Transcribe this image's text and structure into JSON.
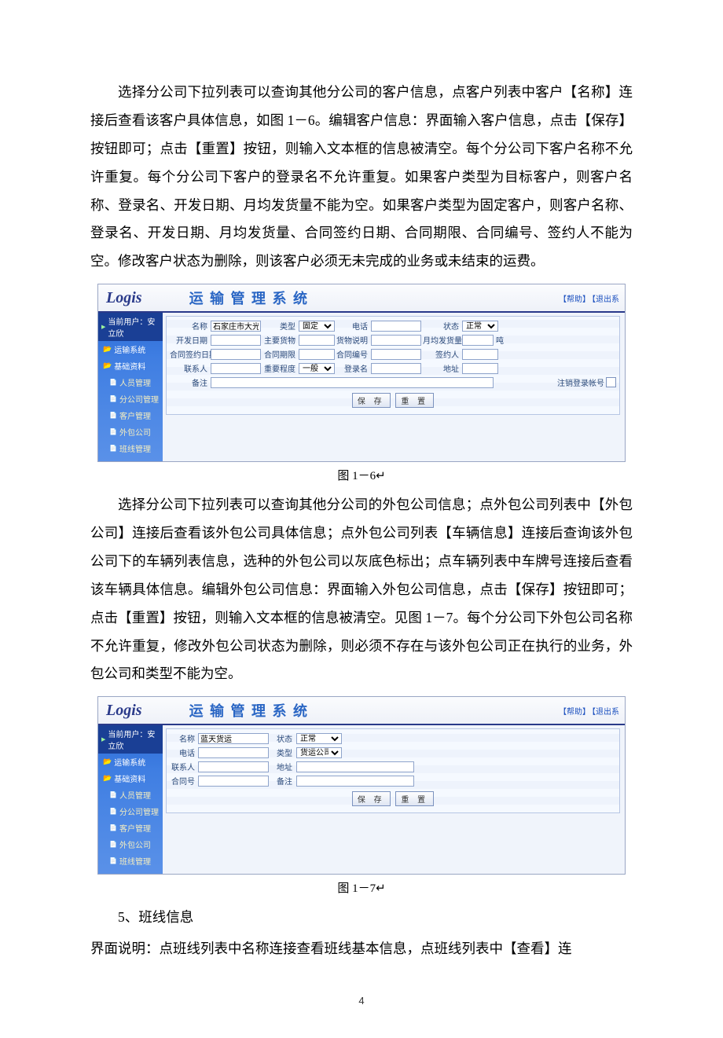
{
  "paragraphs": {
    "p1": "选择分公司下拉列表可以查询其他分公司的客户信息，点客户列表中客户【名称】连接后查看该客户具体信息，如图 1－6。编辑客户信息：界面输入客户信息，点击【保存】按钮即可；点击【重置】按钮，则输入文本框的信息被清空。每个分公司下客户名称不允许重复。每个分公司下客户的登录名不允许重复。如果客户类型为目标客户，则客户名称、登录名、开发日期、月均发货量不能为空。如果客户类型为固定客户，则客户名称、登录名、开发日期、月均发货量、合同签约日期、合同期限、合同编号、签约人不能为空。修改客户状态为删除，则该客户必须无未完成的业务或未结束的运费。",
    "caption1": "图 1－6↵",
    "p2": "选择分公司下拉列表可以查询其他分公司的外包公司信息；点外包公司列表中【外包公司】连接后查看该外包公司具体信息；点外包公司列表【车辆信息】连接后查询该外包公司下的车辆列表信息，选种的外包公司以灰底色标出；点车辆列表中车牌号连接后查看该车辆具体信息。编辑外包公司信息：界面输入外包公司信息，点击【保存】按钮即可；点击【重置】按钮，则输入文本框的信息被清空。见图 1－7。每个分公司下外包公司名称不允许重复，修改外包公司状态为删除，则必须不存在与该外包公司正在执行的业务，外包公司和类型不能为空。",
    "caption2": "图 1－7↵",
    "p3_label": "5、班线信息",
    "p3_body": "界面说明：点班线列表中名称连接查看班线基本信息，点班线列表中【查看】连"
  },
  "page_number": "4",
  "app": {
    "logo": "Logis",
    "title": "运 输 管 理 系 统",
    "help": "【帮助】",
    "logout": "【退出系"
  },
  "sidebar": {
    "user": "当前用户：安立欣",
    "menu_transport": "运输系统",
    "menu_basic": "基础资料",
    "sub_person": "人员管理",
    "sub_branch": "分公司管理",
    "sub_customer": "客户管理",
    "sub_outsource": "外包公司",
    "sub_route": "班线管理"
  },
  "form1": {
    "name_lbl": "名称",
    "name_val": "石家庄市大光明",
    "type_lbl": "类型",
    "type_val": "固定",
    "phone_lbl": "电话",
    "status_lbl": "状态",
    "status_val": "正常",
    "devdate_lbl": "开发日期",
    "goods_lbl": "主要货物",
    "desc_lbl": "货物说明",
    "monthly_lbl": "月均发货量",
    "monthly_unit": "吨",
    "contract_date_lbl": "合同签约日期",
    "contract_term_lbl": "合同期限",
    "contract_no_lbl": "合同编号",
    "signer_lbl": "签约人",
    "contact_lbl": "联系人",
    "importance_lbl": "重要程度",
    "importance_val": "一般",
    "login_lbl": "登录名",
    "addr_lbl": "地址",
    "remark_lbl": "备注",
    "cancel_login_lbl": "注销登录帐号"
  },
  "form2": {
    "name_lbl": "名称",
    "name_val": "蓝天货运",
    "status_lbl": "状态",
    "status_val": "正常",
    "phone_lbl": "电话",
    "type_lbl": "类型",
    "type_val": "货运公司",
    "contact_lbl": "联系人",
    "addr_lbl": "地址",
    "contractno_lbl": "合同号",
    "remark_lbl": "备注"
  },
  "buttons": {
    "save": "保 存",
    "reset": "重 置"
  }
}
